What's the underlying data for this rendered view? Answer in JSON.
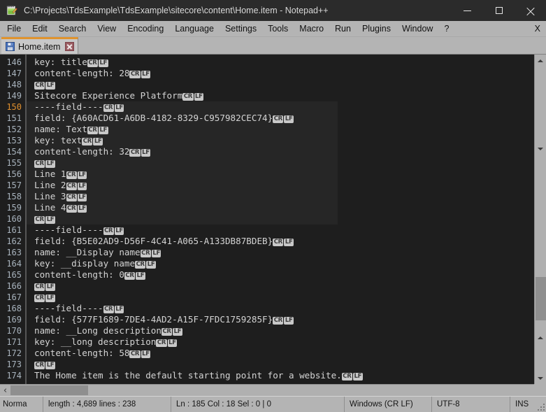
{
  "window": {
    "title": "C:\\Projects\\TdsExample\\TdsExample\\sitecore\\content\\Home.item - Notepad++",
    "app_icon": "notepad-plus-plus-icon",
    "minimize_label": "—",
    "maximize_label": "☐",
    "close_label": "✕"
  },
  "menubar": {
    "items": [
      {
        "label": "File"
      },
      {
        "label": "Edit"
      },
      {
        "label": "Search"
      },
      {
        "label": "View"
      },
      {
        "label": "Encoding"
      },
      {
        "label": "Language"
      },
      {
        "label": "Settings"
      },
      {
        "label": "Tools"
      },
      {
        "label": "Macro"
      },
      {
        "label": "Run"
      },
      {
        "label": "Plugins"
      },
      {
        "label": "Window"
      },
      {
        "label": "?"
      }
    ],
    "close_document_label": "X"
  },
  "tabs": [
    {
      "label": "Home.item",
      "icon": "save-floppy-icon",
      "close_icon": "close-icon",
      "active": true
    }
  ],
  "editor": {
    "accent_color": "#e0942e",
    "background_color": "#1e1e1e",
    "text_color": "#d4d4d4",
    "selection_color": "#262626",
    "current_line_number_color": "#e0902e",
    "line_number_color": "#a8b3bd",
    "current_line": 150,
    "first_visible_line": 146,
    "eol_cr_label": "CR",
    "eol_lf_label": "LF",
    "lines": [
      {
        "n": 146,
        "text": "key: title",
        "eol": true,
        "sel": false
      },
      {
        "n": 147,
        "text": "content-length: 28",
        "eol": true,
        "sel": false
      },
      {
        "n": 148,
        "text": "",
        "eol": true,
        "sel": false
      },
      {
        "n": 149,
        "text": "Sitecore Experience Platform",
        "eol": true,
        "sel": false
      },
      {
        "n": 150,
        "text": "----field----",
        "eol": true,
        "sel": true
      },
      {
        "n": 151,
        "text": "field: {A60ACD61-A6DB-4182-8329-C957982CEC74}",
        "eol": true,
        "sel": true
      },
      {
        "n": 152,
        "text": "name: Text",
        "eol": true,
        "sel": true
      },
      {
        "n": 153,
        "text": "key: text",
        "eol": true,
        "sel": true
      },
      {
        "n": 154,
        "text": "content-length: 32",
        "eol": true,
        "sel": true
      },
      {
        "n": 155,
        "text": "",
        "eol": true,
        "sel": true
      },
      {
        "n": 156,
        "text": "Line 1",
        "eol": true,
        "sel": true
      },
      {
        "n": 157,
        "text": "Line 2",
        "eol": true,
        "sel": true
      },
      {
        "n": 158,
        "text": "Line 3",
        "eol": true,
        "sel": true
      },
      {
        "n": 159,
        "text": "Line 4",
        "eol": true,
        "sel": true
      },
      {
        "n": 160,
        "text": "",
        "eol": true,
        "sel": true
      },
      {
        "n": 161,
        "text": "----field----",
        "eol": true,
        "sel": false
      },
      {
        "n": 162,
        "text": "field: {B5E02AD9-D56F-4C41-A065-A133DB87BDEB}",
        "eol": true,
        "sel": false
      },
      {
        "n": 163,
        "text": "name: __Display name",
        "eol": true,
        "sel": false
      },
      {
        "n": 164,
        "text": "key: __display name",
        "eol": true,
        "sel": false
      },
      {
        "n": 165,
        "text": "content-length: 0",
        "eol": true,
        "sel": false
      },
      {
        "n": 166,
        "text": "",
        "eol": true,
        "sel": false
      },
      {
        "n": 167,
        "text": "",
        "eol": true,
        "sel": false
      },
      {
        "n": 168,
        "text": "----field----",
        "eol": true,
        "sel": false
      },
      {
        "n": 169,
        "text": "field: {577F1689-7DE4-4AD2-A15F-7FDC1759285F}",
        "eol": true,
        "sel": false
      },
      {
        "n": 170,
        "text": "name: __Long description",
        "eol": true,
        "sel": false
      },
      {
        "n": 171,
        "text": "key: __long description",
        "eol": true,
        "sel": false
      },
      {
        "n": 172,
        "text": "content-length: 58",
        "eol": true,
        "sel": false
      },
      {
        "n": 173,
        "text": "",
        "eol": true,
        "sel": false
      },
      {
        "n": 174,
        "text": "The Home item is the default starting point for a website.",
        "eol": true,
        "sel": false
      }
    ]
  },
  "scrollbars": {
    "vertical_up_icon": "chevron-up-icon",
    "vertical_down_icon": "chevron-down-icon",
    "horizontal_left_icon": "chevron-left-icon",
    "horizontal_right_icon": "chevron-right-icon",
    "horizontal_left_label": "‹",
    "horizontal_right_label": "›"
  },
  "statusbar": {
    "mode": "Norma",
    "length_lines": "length : 4,689    lines : 238",
    "position": "Ln : 185    Col : 18    Sel : 0 | 0",
    "eol_format": "Windows (CR LF)",
    "encoding": "UTF-8",
    "insert_mode": "INS"
  }
}
